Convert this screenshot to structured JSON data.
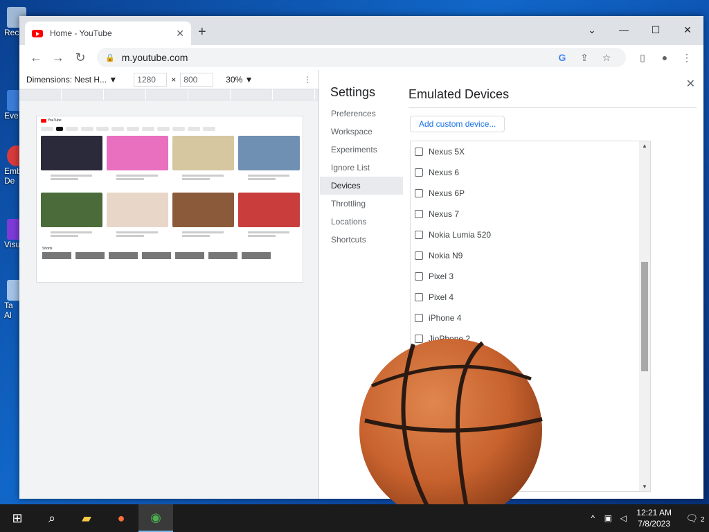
{
  "desktop": {
    "icons": [
      {
        "label": "Rec"
      },
      {
        "label": "Eve"
      },
      {
        "label": "Emb De"
      },
      {
        "label": "Visu"
      },
      {
        "label": "Ta Al"
      }
    ]
  },
  "browser": {
    "tab_title": "Home - YouTube",
    "url": "m.youtube.com",
    "new_tab": "+",
    "window_controls": {
      "minimize": "—",
      "maximize": "☐",
      "close": "✕",
      "tab_search": "⌄"
    }
  },
  "device_toolbar": {
    "dimensions_label": "Dimensions: Nest H...",
    "width": "1280",
    "height": "800",
    "times": "×",
    "zoom": "30%"
  },
  "viewport": {
    "yt_label": "YouTube",
    "shorts_label": "Shorts",
    "videos": [
      {
        "color": "#2a2a3a"
      },
      {
        "color": "#e96fbf"
      },
      {
        "color": "#d6c7a1"
      },
      {
        "color": "#6f8fb3"
      },
      {
        "color": "#4b6b3a"
      },
      {
        "color": "#e8d6c8"
      },
      {
        "color": "#8b5a3a"
      },
      {
        "color": "#c93d3d"
      }
    ]
  },
  "settings": {
    "title": "Settings",
    "nav": [
      "Preferences",
      "Workspace",
      "Experiments",
      "Ignore List",
      "Devices",
      "Throttling",
      "Locations",
      "Shortcuts"
    ],
    "active": "Devices",
    "panel_title": "Emulated Devices",
    "add_button": "Add custom device...",
    "close": "✕",
    "devices": [
      "Nexus 5X",
      "Nexus 6",
      "Nexus 6P",
      "Nexus 7",
      "Nokia Lumia 520",
      "Nokia N9",
      "Pixel 3",
      "Pixel 4",
      "iPhone 4",
      "JioPhone 2"
    ]
  },
  "taskbar": {
    "time": "12:21 AM",
    "date": "7/8/2023",
    "notification_count": "2"
  },
  "colors": {
    "accent": "#1a73e8",
    "youtube_red": "#ff0000",
    "ball": "#c8622e"
  }
}
